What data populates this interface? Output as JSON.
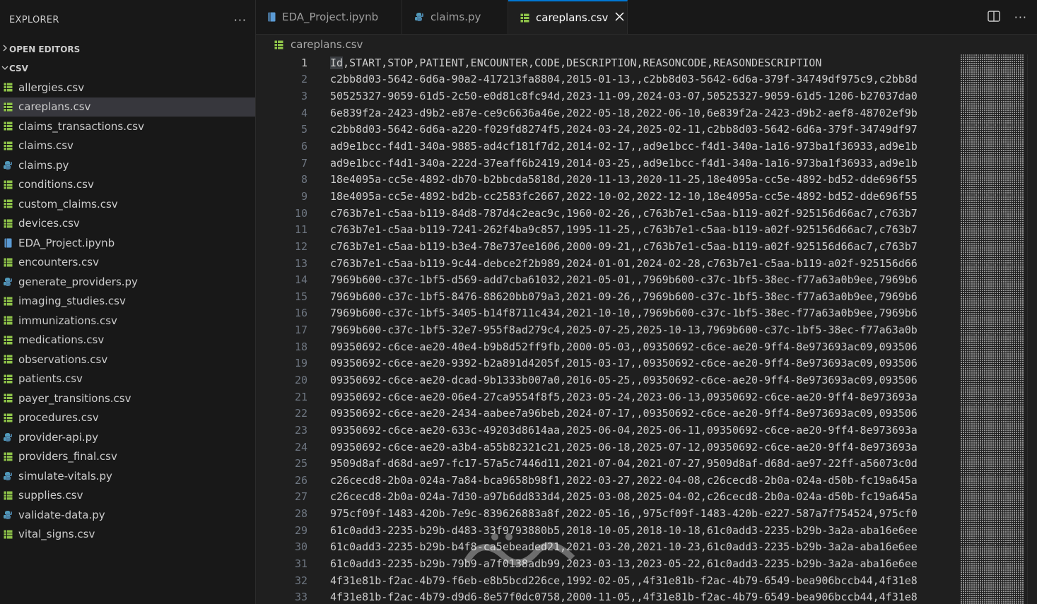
{
  "sidebar": {
    "title": "EXPLORER",
    "open_editors": "OPEN EDITORS",
    "folder": "CSV",
    "files": [
      {
        "name": "allergies.csv",
        "type": "csv",
        "active": false
      },
      {
        "name": "careplans.csv",
        "type": "csv",
        "active": true
      },
      {
        "name": "claims_transactions.csv",
        "type": "csv",
        "active": false
      },
      {
        "name": "claims.csv",
        "type": "csv",
        "active": false
      },
      {
        "name": "claims.py",
        "type": "py",
        "active": false
      },
      {
        "name": "conditions.csv",
        "type": "csv",
        "active": false
      },
      {
        "name": "custom_claims.csv",
        "type": "csv",
        "active": false
      },
      {
        "name": "devices.csv",
        "type": "csv",
        "active": false
      },
      {
        "name": "EDA_Project.ipynb",
        "type": "ipynb",
        "active": false
      },
      {
        "name": "encounters.csv",
        "type": "csv",
        "active": false
      },
      {
        "name": "generate_providers.py",
        "type": "py",
        "active": false
      },
      {
        "name": "imaging_studies.csv",
        "type": "csv",
        "active": false
      },
      {
        "name": "immunizations.csv",
        "type": "csv",
        "active": false
      },
      {
        "name": "medications.csv",
        "type": "csv",
        "active": false
      },
      {
        "name": "observations.csv",
        "type": "csv",
        "active": false
      },
      {
        "name": "patients.csv",
        "type": "csv",
        "active": false
      },
      {
        "name": "payer_transitions.csv",
        "type": "csv",
        "active": false
      },
      {
        "name": "procedures.csv",
        "type": "csv",
        "active": false
      },
      {
        "name": "provider-api.py",
        "type": "py",
        "active": false
      },
      {
        "name": "providers_final.csv",
        "type": "csv",
        "active": false
      },
      {
        "name": "simulate-vitals.py",
        "type": "py",
        "active": false
      },
      {
        "name": "supplies.csv",
        "type": "csv",
        "active": false
      },
      {
        "name": "validate-data.py",
        "type": "py",
        "active": false
      },
      {
        "name": "vital_signs.csv",
        "type": "csv",
        "active": false
      }
    ]
  },
  "tabs": [
    {
      "label": "EDA_Project.ipynb",
      "type": "ipynb",
      "active": false
    },
    {
      "label": "claims.py",
      "type": "py",
      "active": false
    },
    {
      "label": "careplans.csv",
      "type": "csv",
      "active": true
    }
  ],
  "breadcrumb": "careplans.csv",
  "colors": {
    "csv_icon": "#8dc149",
    "py_icon": "#519aba",
    "ipynb_icon": "#5b9bd5",
    "accent": "#0078d4"
  },
  "lines": [
    "Id,START,STOP,PATIENT,ENCOUNTER,CODE,DESCRIPTION,REASONCODE,REASONDESCRIPTION",
    "c2bb8d03-5642-6d6a-90a2-417213fa8804,2015-01-13,,c2bb8d03-5642-6d6a-379f-34749df975c9,c2bb8d",
    "50525327-9059-61d5-2c50-e0d81c8fc94d,2023-11-09,2024-03-07,50525327-9059-61d5-1206-b27037da0",
    "6e839f2a-2423-d9b2-e87e-ce9c6636a46e,2022-05-18,2022-06-10,6e839f2a-2423-d9b2-aef8-48702ef9b",
    "c2bb8d03-5642-6d6a-a220-f029fd8274f5,2024-03-24,2025-02-11,c2bb8d03-5642-6d6a-379f-34749df97",
    "ad9e1bcc-f4d1-340a-9885-ad4cf181f7d2,2014-02-17,,ad9e1bcc-f4d1-340a-1a16-973ba1f36933,ad9e1b",
    "ad9e1bcc-f4d1-340a-222d-37eaff6b2419,2014-03-25,,ad9e1bcc-f4d1-340a-1a16-973ba1f36933,ad9e1b",
    "18e4095a-cc5e-4892-db70-b2bbcda5818d,2020-11-13,2020-11-25,18e4095a-cc5e-4892-bd52-dde696f55",
    "18e4095a-cc5e-4892-bd2b-cc2583fc2667,2022-10-02,2022-12-10,18e4095a-cc5e-4892-bd52-dde696f55",
    "c763b7e1-c5aa-b119-84d8-787d4c2eac9c,1960-02-26,,c763b7e1-c5aa-b119-a02f-925156d66ac7,c763b7",
    "c763b7e1-c5aa-b119-7241-262f4ba9c857,1995-11-25,,c763b7e1-c5aa-b119-a02f-925156d66ac7,c763b7",
    "c763b7e1-c5aa-b119-b3e4-78e737ee1606,2000-09-21,,c763b7e1-c5aa-b119-a02f-925156d66ac7,c763b7",
    "c763b7e1-c5aa-b119-9c44-debce2f2b989,2024-01-01,2024-02-28,c763b7e1-c5aa-b119-a02f-925156d66",
    "7969b600-c37c-1bf5-d569-add7cba61032,2021-05-01,,7969b600-c37c-1bf5-38ec-f77a63a0b9ee,7969b6",
    "7969b600-c37c-1bf5-8476-88620bb079a3,2021-09-26,,7969b600-c37c-1bf5-38ec-f77a63a0b9ee,7969b6",
    "7969b600-c37c-1bf5-3405-b14f8711c434,2021-10-10,,7969b600-c37c-1bf5-38ec-f77a63a0b9ee,7969b6",
    "7969b600-c37c-1bf5-32e7-955f8ad279c4,2025-07-25,2025-10-13,7969b600-c37c-1bf5-38ec-f77a63a0b",
    "09350692-c6ce-ae20-40e4-b9b8d52ff9fb,2000-05-03,,09350692-c6ce-ae20-9ff4-8e973693ac09,093506",
    "09350692-c6ce-ae20-9392-b2a891d4205f,2015-03-17,,09350692-c6ce-ae20-9ff4-8e973693ac09,093506",
    "09350692-c6ce-ae20-dcad-9b1333b007a0,2016-05-25,,09350692-c6ce-ae20-9ff4-8e973693ac09,093506",
    "09350692-c6ce-ae20-06e4-27ca9554f8f5,2023-05-24,2023-06-13,09350692-c6ce-ae20-9ff4-8e973693a",
    "09350692-c6ce-ae20-2434-aabee7a96beb,2024-07-17,,09350692-c6ce-ae20-9ff4-8e973693ac09,093506",
    "09350692-c6ce-ae20-633c-49203d8614aa,2025-06-04,2025-06-11,09350692-c6ce-ae20-9ff4-8e973693a",
    "09350692-c6ce-ae20-a3b4-a55b82321c21,2025-06-18,2025-07-12,09350692-c6ce-ae20-9ff4-8e973693a",
    "9509d8af-d68d-ae97-fc17-57a5c7446d11,2021-07-04,2021-07-27,9509d8af-d68d-ae97-22ff-a56073c0d",
    "c26cecd8-2b0a-024a-7a84-bca9658b98f1,2022-03-27,2022-04-08,c26cecd8-2b0a-024a-d50b-fc19a645a",
    "c26cecd8-2b0a-024a-7d30-a97b6dd833d4,2025-03-08,2025-04-02,c26cecd8-2b0a-024a-d50b-fc19a645a",
    "975cf09f-1483-420b-7e9c-839626883a8f,2022-05-16,,975cf09f-1483-420b-e227-587a7f754524,975cf0",
    "61c0add3-2235-b29b-d483-33f9793880b5,2018-10-05,2018-10-18,61c0add3-2235-b29b-3a2a-aba16e6ee",
    "61c0add3-2235-b29b-b4f8-ca5ebeaded21,2021-03-20,2021-10-23,61c0add3-2235-b29b-3a2a-aba16e6ee",
    "61c0add3-2235-b29b-79b9-a7f0138adb99,2023-03-13,2023-05-22,61c0add3-2235-b29b-3a2a-aba16e6ee",
    "4f31e81b-f2ac-4b79-f6eb-e8b5bcd226ce,1992-02-05,,4f31e81b-f2ac-4b79-6549-bea906bccb44,4f31e8",
    "4f31e81b-f2ac-4b79-d9d6-8e57f0dc0758,2000-11-05,,4f31e81b-f2ac-4b79-6549-bea906bccb44,4f31e8"
  ],
  "current_line": 1
}
